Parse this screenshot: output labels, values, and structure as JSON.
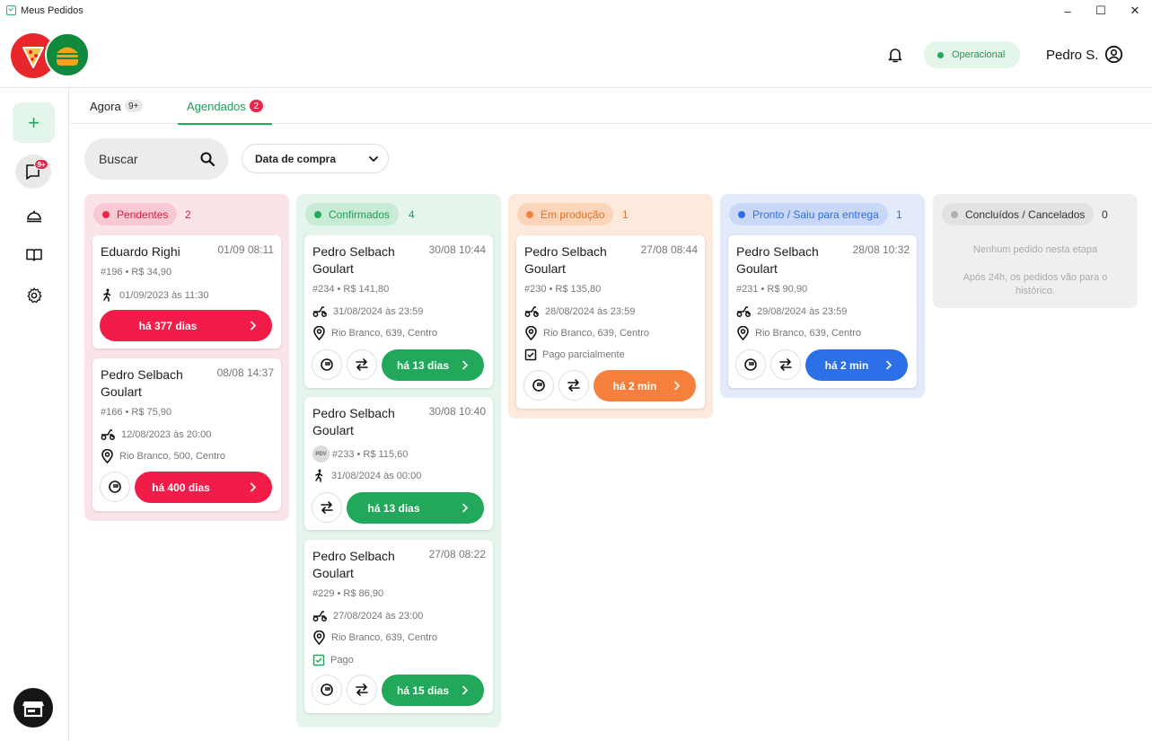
{
  "window": {
    "title": "Meus Pedidos",
    "minimize": "–",
    "maximize": "☐",
    "close": "✕"
  },
  "header": {
    "status": "Operacional",
    "user_name": "Pedro S."
  },
  "sidebar": {
    "add_label": "+",
    "orders_badge": "9+"
  },
  "tabs": [
    {
      "label": "Agora",
      "count": "9+"
    },
    {
      "label": "Agendados",
      "count": "2"
    }
  ],
  "search": {
    "placeholder": "Buscar"
  },
  "filter": {
    "label": "Data de compra"
  },
  "colors": {
    "pendentes": "#e8274b",
    "confirmados": "#22a85a",
    "producao": "#f5803e",
    "pronto": "#2d6fe6",
    "concluidos": "#b0b0b0"
  },
  "columns": [
    {
      "title": "Pendentes",
      "count": "2",
      "cards": [
        {
          "name": "Eduardo Righi",
          "date": "01/09 08:11",
          "order": "#196 • R$ 34,90",
          "schedule": "01/09/2023 às 11:30",
          "schedule_icon": "walk-icon",
          "button": "há 377 dias"
        },
        {
          "name": "Pedro Selbach Goulart",
          "date": "08/08 14:37",
          "order": "#166 • R$ 75,90",
          "schedule": "12/08/2023 às 20:00",
          "schedule_icon": "delivery-icon",
          "address": "Rio Branco, 500, Centro",
          "button": "há 400 dias"
        }
      ]
    },
    {
      "title": "Confirmados",
      "count": "4",
      "cards": [
        {
          "name": "Pedro Selbach Goulart",
          "date": "30/08 10:44",
          "order": "#234 • R$ 141,80",
          "schedule": "31/08/2024 às 23:59",
          "address": "Rio Branco, 639, Centro",
          "button": "há 13 dias"
        },
        {
          "name": "Pedro Selbach Goulart",
          "date": "30/08 10:40",
          "pdv": "PDV",
          "order": "#233 • R$ 115,60",
          "schedule": "31/08/2024 às 00:00",
          "button": "há 13 dias"
        },
        {
          "name": "Pedro Selbach Goulart",
          "date": "27/08 08:22",
          "order": "#229 • R$ 86,90",
          "schedule": "27/08/2024 às 23:00",
          "address": "Rio Branco, 639, Centro",
          "payment": "Pago",
          "button": "há 15 dias"
        }
      ]
    },
    {
      "title": "Em produção",
      "count": "1",
      "cards": [
        {
          "name": "Pedro Selbach Goulart",
          "date": "27/08 08:44",
          "order": "#230 • R$ 135,80",
          "schedule": "28/08/2024 às 23:59",
          "address": "Rio Branco, 639, Centro",
          "payment": "Pago parcialmente",
          "button": "há 2 min"
        }
      ]
    },
    {
      "title": "Pronto / Saiu para entrega",
      "count": "1",
      "cards": [
        {
          "name": "Pedro Selbach Goulart",
          "date": "28/08 10:32",
          "order": "#231 • R$ 90,90",
          "schedule": "29/08/2024 às 23:59",
          "address": "Rio Branco, 639, Centro",
          "button": "há 2 min"
        }
      ]
    },
    {
      "title": "Concluídos / Cancelados",
      "count": "0",
      "empty_title": "Nenhum pedido nesta etapa",
      "empty_desc": "Após 24h, os pedidos vão para o histórico."
    }
  ]
}
